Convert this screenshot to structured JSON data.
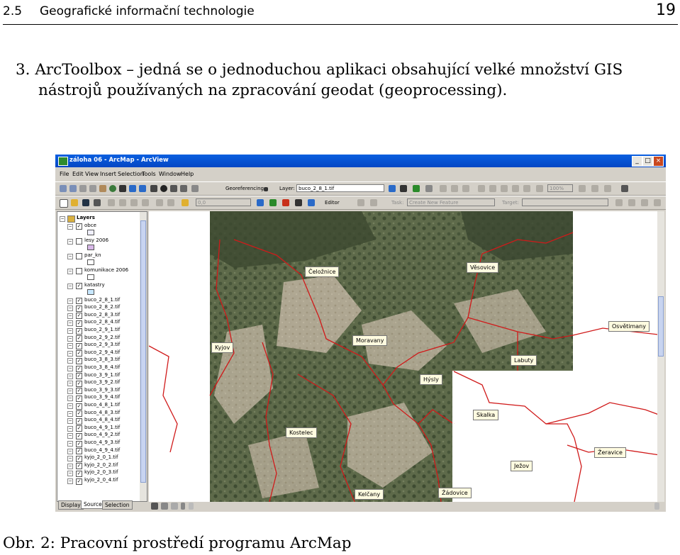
{
  "header": {
    "section": "2.5",
    "title": "Geografické informační technologie",
    "page": "19"
  },
  "paragraph": {
    "line1": "3. ArcToolbox – jedná se o jednoduchou aplikaci obsahující velké množství GIS",
    "line2": "nástrojů používaných na zpracování geodat (geoprocessing)."
  },
  "caption": "Obr. 2: Pracovní prostředí programu ArcMap",
  "window": {
    "title": "záloha 06 - ArcMap - ArcView",
    "menu": [
      "File",
      "Edit",
      "View",
      "Insert",
      "Selection",
      "Tools",
      "Window",
      "Help"
    ],
    "georef_label": "Georeferencing",
    "layer_label": "Layer:",
    "layer_value": "buco_2_8_1.tif",
    "scale_value": "0,0",
    "editor_label": "Editor",
    "task_label": "Task:",
    "task_value": "Create New Feature",
    "target_label": "Target:",
    "zoom_value": "100%"
  },
  "toc": {
    "root": "Layers",
    "layers": [
      "obce",
      "lesy 2006",
      "par_kn",
      "komunikace 2006",
      "katastry",
      "buco_2_8_1.tif",
      "buco_2_8_2.tif",
      "buco_2_8_3.tif",
      "buco_2_8_4.tif",
      "buco_2_9_1.tif",
      "buco_2_9_2.tif",
      "buco_2_9_3.tif",
      "buco_2_9_4.tif",
      "buco_3_8_3.tif",
      "buco_3_8_4.tif",
      "buco_3_9_1.tif",
      "buco_3_9_2.tif",
      "buco_3_9_3.tif",
      "buco_3_9_4.tif",
      "buco_4_8_1.tif",
      "buco_4_8_3.tif",
      "buco_4_8_4.tif",
      "buco_4_9_1.tif",
      "buco_4_9_2.tif",
      "buco_4_9_3.tif",
      "buco_4_9_4.tif",
      "kyjo_2_0_1.tif",
      "kyjo_2_0_2.tif",
      "kyjo_2_0_3.tif",
      "kyjo_2_0_4.tif"
    ],
    "tabs": [
      "Display",
      "Source",
      "Selection"
    ]
  },
  "map": {
    "places": [
      "Čeložnice",
      "Věsovice",
      "Osvětimany",
      "Kyjov",
      "Moravany",
      "Labuty",
      "Hýsly",
      "Skalka",
      "Kostelec",
      "Žeravice",
      "Ježov",
      "Kelčany",
      "Žádovice"
    ]
  },
  "colors": {
    "titlebar": "#0a5fe0",
    "boundary": "#d01a1a",
    "label_bg": "#fffbe0"
  }
}
